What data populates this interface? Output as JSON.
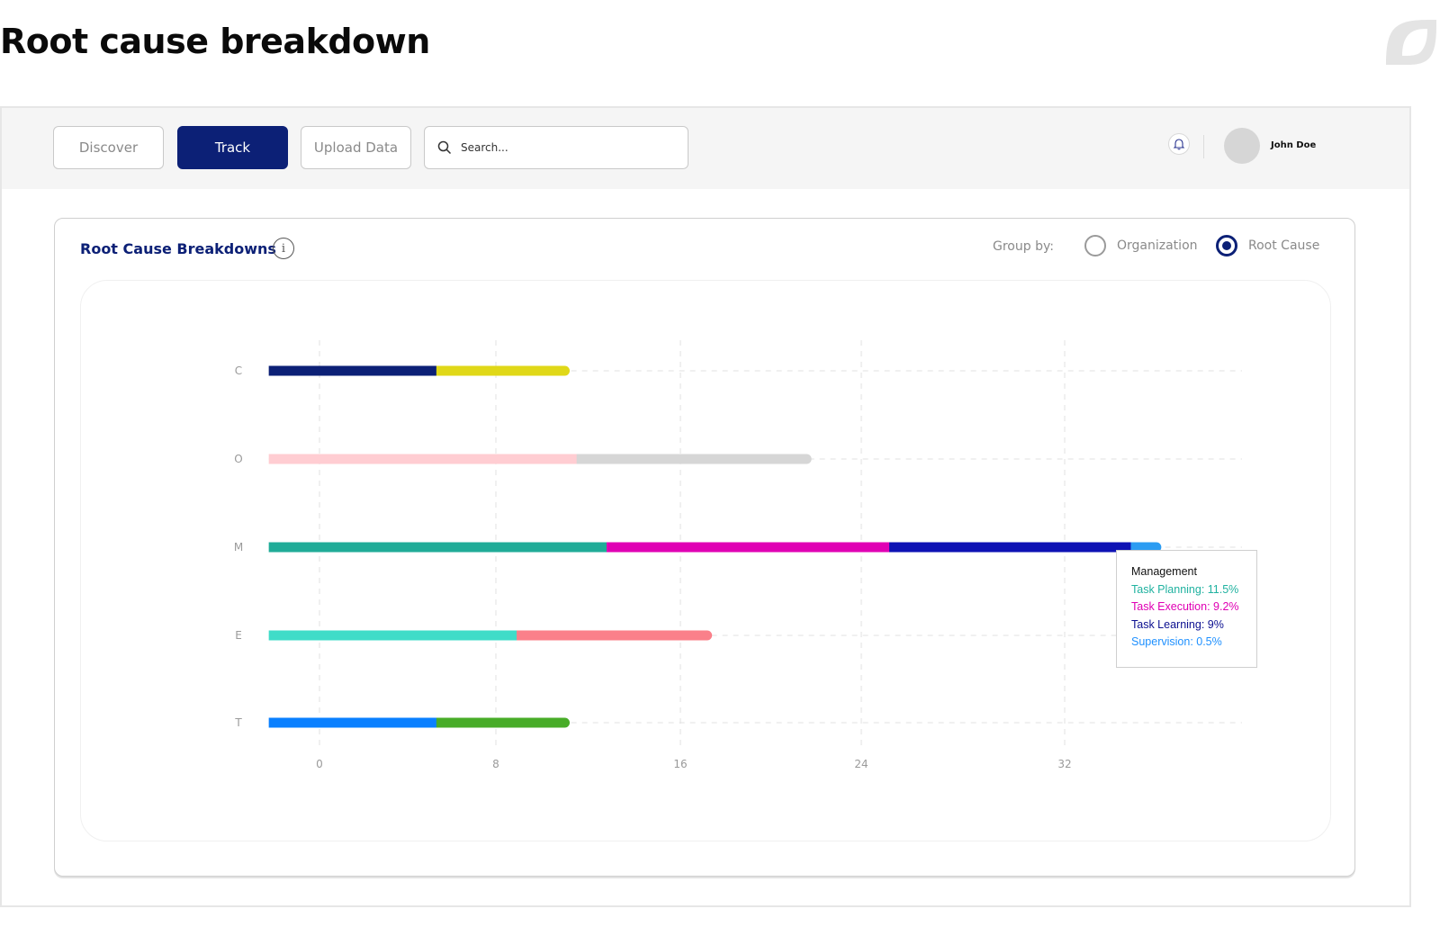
{
  "page": {
    "title": "Root cause breakdown"
  },
  "topbar": {
    "nav": [
      {
        "label": "Discover",
        "active": false
      },
      {
        "label": "Track",
        "active": true
      },
      {
        "label": "Upload Data",
        "active": false
      }
    ],
    "search_placeholder": "Search...",
    "user_name": "John Doe"
  },
  "card": {
    "title": "Root Cause Breakdowns",
    "group_by_label": "Group by:",
    "group_by_options": [
      {
        "label": "Organization",
        "checked": false
      },
      {
        "label": "Root Cause",
        "checked": true
      }
    ]
  },
  "tooltip": {
    "title": "Management",
    "lines": [
      {
        "text": "Task Planning: 11.5%",
        "color": "#20b2a0"
      },
      {
        "text": "Task Execution: 9.2%",
        "color": "#e000b4"
      },
      {
        "text": "Task Learning: 9%",
        "color": "#0c1090"
      },
      {
        "text": "Supervision: 0.5%",
        "color": "#1e90ff"
      }
    ]
  },
  "chart_data": {
    "type": "bar",
    "orientation": "horizontal",
    "stacked": true,
    "categories": [
      "C",
      "O",
      "M",
      "E",
      "T"
    ],
    "x_ticks": [
      0,
      8,
      16,
      24,
      32
    ],
    "xlim": [
      -2.3,
      40
    ],
    "grid": true,
    "bar_start": -2.3,
    "bars": [
      {
        "category": "C",
        "segments": [
          {
            "value": 7.6,
            "color": "#0c2076"
          },
          {
            "value": 5.9,
            "color": "#e0d818"
          }
        ]
      },
      {
        "category": "O",
        "segments": [
          {
            "value": 13.8,
            "color": "#ffcdd2"
          },
          {
            "value": 10.3,
            "color": "#d6d6d6"
          }
        ]
      },
      {
        "category": "M",
        "segments": [
          {
            "value": 15.1,
            "color": "#20ac98"
          },
          {
            "value": 12.3,
            "color": "#e000b4"
          },
          {
            "value": 9.5,
            "color": "#0e12b4"
          },
          {
            "value": 1.2,
            "color": "#2b9cf2"
          }
        ]
      },
      {
        "category": "E",
        "segments": [
          {
            "value": 11.2,
            "color": "#40dcc8"
          },
          {
            "value": 8.5,
            "color": "#fa808a"
          }
        ]
      },
      {
        "category": "T",
        "segments": [
          {
            "value": 7.6,
            "color": "#0a80ff"
          },
          {
            "value": 5.9,
            "color": "#48ac28"
          }
        ]
      }
    ],
    "title": "",
    "xlabel": "",
    "ylabel": ""
  }
}
